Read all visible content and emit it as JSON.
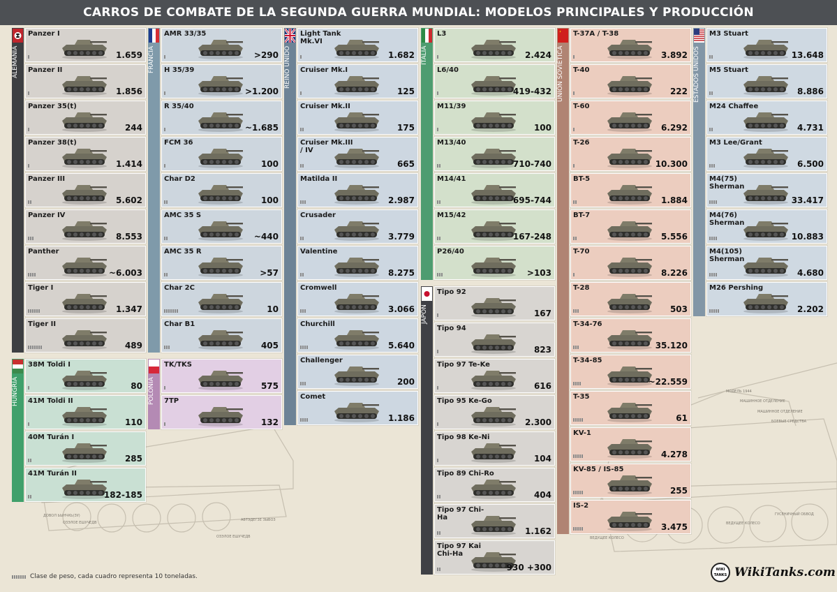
{
  "title": "CARROS DE COMBATE DE LA SEGUNDA GUERRA MUNDIAL: MODELOS PRINCIPALES Y PRODUCCIÓN",
  "legend": "Clase de peso, cada cuadro representa 10 toneladas.",
  "brand": {
    "name": "WikiTanks.com",
    "logo_text": "WIKI TANKS"
  },
  "background_labels": [
    "МОДЕЛЬ 1944",
    "МАШИННОЕ ОТДЕЛЕНИЕ",
    "МАШИННОЕ ОТДЕЛЕНИЕ",
    "БОЕВЫЕ СРЕДСТВА",
    "ГУСЕНИЧНЫЙ ОБВОД",
    "ВЕДУЩЕЕ КОЛЕСО",
    "ВЕДУЩЕЕ КОЛЕСО",
    "ДОВОЛ ЬЫНЧКЬ(ЗУ)",
    "ОЗЭЛОЕ ЕШУЧЕДВ",
    "АВТЭДЕГ3Е ЗЫВОЗ",
    "ОЗЭЛОЕ ЕШУЧЕДВ"
  ],
  "colors": {
    "germany": "#3d3f42",
    "hungary": "#40a06b",
    "france": "#7f9aaa",
    "poland": "#b48ab4",
    "uk": "#6d8396",
    "italy": "#4e9c70",
    "japan": "#3f4045",
    "ussr": "#b08473",
    "usa": "#8296a6"
  },
  "sections": [
    {
      "id": "germany",
      "label": "ALEMANIA",
      "flag": "germany-flag-icon",
      "tanks": [
        {
          "name": "Panzer I",
          "count": "1.659",
          "weight": 1
        },
        {
          "name": "Panzer II",
          "count": "1.856",
          "weight": 1
        },
        {
          "name": "Panzer 35(t)",
          "count": "244",
          "weight": 1
        },
        {
          "name": "Panzer 38(t)",
          "count": "1.414",
          "weight": 1
        },
        {
          "name": "Panzer III",
          "count": "5.602",
          "weight": 2
        },
        {
          "name": "Panzer IV",
          "count": "8.553",
          "weight": 3
        },
        {
          "name": "Panther",
          "count": "~6.003",
          "weight": 4
        },
        {
          "name": "Tiger I",
          "count": "1.347",
          "weight": 6
        },
        {
          "name": "Tiger II",
          "count": "489",
          "weight": 7
        }
      ]
    },
    {
      "id": "hungary",
      "label": "HUNGRÍA",
      "flag": "hungary-flag-icon",
      "tanks": [
        {
          "name": "38M Toldi I",
          "count": "80",
          "weight": 1
        },
        {
          "name": "41M Toldi II",
          "count": "110",
          "weight": 1
        },
        {
          "name": "40M Turán I",
          "count": "285",
          "weight": 2
        },
        {
          "name": "41M Turán II",
          "count": "182-185",
          "weight": 2
        }
      ]
    },
    {
      "id": "france",
      "label": "FRANCIA",
      "flag": "france-flag-icon",
      "tanks": [
        {
          "name": "AMR 33/35",
          "count": ">290",
          "weight": 1
        },
        {
          "name": "H 35/39",
          "count": ">1.200",
          "weight": 1
        },
        {
          "name": "R 35/40",
          "count": "~1.685",
          "weight": 1
        },
        {
          "name": "FCM 36",
          "count": "100",
          "weight": 1
        },
        {
          "name": "Char D2",
          "count": "100",
          "weight": 2
        },
        {
          "name": "AMC 35 S",
          "count": "~440",
          "weight": 2
        },
        {
          "name": "AMC 35 R",
          "count": ">57",
          "weight": 2
        },
        {
          "name": "Char 2C",
          "count": "10",
          "weight": 7
        },
        {
          "name": "Char B1",
          "count": "405",
          "weight": 3
        }
      ]
    },
    {
      "id": "poland",
      "label": "POLONIA",
      "flag": "poland-flag-icon",
      "tanks": [
        {
          "name": "TK/TKS",
          "count": "575",
          "weight": 1
        },
        {
          "name": "7TP",
          "count": "132",
          "weight": 1
        }
      ]
    },
    {
      "id": "uk",
      "label": "REINO UNIDO",
      "flag": "uk-flag-icon",
      "tanks": [
        {
          "name": "Light Tank Mk.VI",
          "count": "1.682",
          "weight": 1
        },
        {
          "name": "Cruiser Mk.I",
          "count": "125",
          "weight": 1
        },
        {
          "name": "Cruiser Mk.II",
          "count": "175",
          "weight": 2
        },
        {
          "name": "Cruiser Mk.III / IV",
          "count": "665",
          "weight": 2
        },
        {
          "name": "Matilda II",
          "count": "2.987",
          "weight": 3
        },
        {
          "name": "Crusader",
          "count": "3.779",
          "weight": 2
        },
        {
          "name": "Valentine",
          "count": "8.275",
          "weight": 2
        },
        {
          "name": "Cromwell",
          "count": "3.066",
          "weight": 3
        },
        {
          "name": "Churchill",
          "count": "5.640",
          "weight": 4
        },
        {
          "name": "Challenger",
          "count": "200",
          "weight": 3
        },
        {
          "name": "Comet",
          "count": "1.186",
          "weight": 4
        }
      ]
    },
    {
      "id": "italy",
      "label": "ITALIA",
      "flag": "italy-flag-icon",
      "tanks": [
        {
          "name": "L3",
          "count": "2.424",
          "weight": 1
        },
        {
          "name": "L6/40",
          "count": "419-432",
          "weight": 1
        },
        {
          "name": "M11/39",
          "count": "100",
          "weight": 1
        },
        {
          "name": "M13/40",
          "count": "710-740",
          "weight": 2
        },
        {
          "name": "M14/41",
          "count": "695-744",
          "weight": 2
        },
        {
          "name": "M15/42",
          "count": "167-248",
          "weight": 2
        },
        {
          "name": "P26/40",
          "count": ">103",
          "weight": 3
        }
      ]
    },
    {
      "id": "japan",
      "label": "JAPÓN",
      "flag": "japan-flag-icon",
      "tanks": [
        {
          "name": "Tipo 92",
          "count": "167",
          "weight": 1
        },
        {
          "name": "Tipo 94",
          "count": "823",
          "weight": 1
        },
        {
          "name": "Tipo 97 Te-Ke",
          "count": "616",
          "weight": 1
        },
        {
          "name": "Tipo 95 Ke-Go",
          "count": "2.300",
          "weight": 1
        },
        {
          "name": "Tipo 98 Ke-Ni",
          "count": "104",
          "weight": 1
        },
        {
          "name": "Tipo 89 Chi-Ro",
          "count": "404",
          "weight": 2
        },
        {
          "name": "Tipo 97 Chi-Ha",
          "count": "1.162",
          "weight": 2
        },
        {
          "name": "Tipo 97 Kai Chi-Ha",
          "count": "930 +300",
          "weight": 2
        }
      ]
    },
    {
      "id": "ussr",
      "label": "UNIÓN SOVIÉTICA",
      "flag": "ussr-flag-icon",
      "tanks": [
        {
          "name": "T-37A / T-38",
          "count": "3.892",
          "weight": 1
        },
        {
          "name": "T-40",
          "count": "222",
          "weight": 1
        },
        {
          "name": "T-60",
          "count": "6.292",
          "weight": 1
        },
        {
          "name": "T-26",
          "count": "10.300",
          "weight": 1
        },
        {
          "name": "BT-5",
          "count": "1.884",
          "weight": 2
        },
        {
          "name": "BT-7",
          "count": "5.556",
          "weight": 2
        },
        {
          "name": "T-70",
          "count": "8.226",
          "weight": 1
        },
        {
          "name": "T-28",
          "count": "503",
          "weight": 3
        },
        {
          "name": "T-34-76",
          "count": "35.120",
          "weight": 3
        },
        {
          "name": "T-34-85",
          "count": "~22.559",
          "weight": 4
        },
        {
          "name": "T-35",
          "count": "61",
          "weight": 5
        },
        {
          "name": "KV-1",
          "count": "4.278",
          "weight": 5
        },
        {
          "name": "KV-85 / IS-85",
          "count": "255",
          "weight": 5
        },
        {
          "name": "IS-2",
          "count": "3.475",
          "weight": 5
        }
      ]
    },
    {
      "id": "usa",
      "label": "ESTADOS UNIDOS",
      "flag": "usa-flag-icon",
      "tanks": [
        {
          "name": "M3 Stuart",
          "count": "13.648",
          "weight": 2
        },
        {
          "name": "M5 Stuart",
          "count": "8.886",
          "weight": 2
        },
        {
          "name": "M24 Chaffee",
          "count": "4.731",
          "weight": 2
        },
        {
          "name": "M3 Lee/Grant",
          "count": "6.500",
          "weight": 3
        },
        {
          "name": "M4(75) Sherman",
          "count": "33.417",
          "weight": 4
        },
        {
          "name": "M4(76) Sherman",
          "count": "10.883",
          "weight": 4
        },
        {
          "name": "M4(105) Sherman",
          "count": "4.680",
          "weight": 4
        },
        {
          "name": "M26 Pershing",
          "count": "2.202",
          "weight": 5
        }
      ]
    }
  ]
}
